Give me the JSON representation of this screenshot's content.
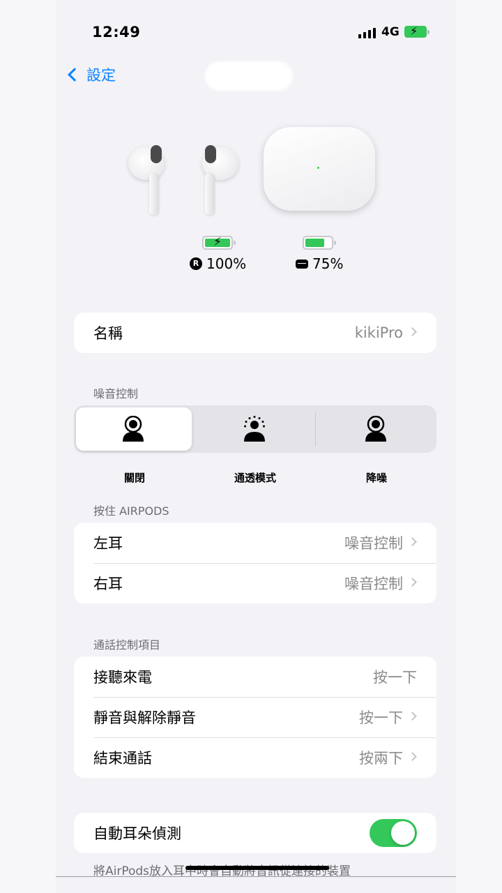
{
  "status_bar": {
    "time": "12:49",
    "network": "4G"
  },
  "nav": {
    "back_label": "設定"
  },
  "battery": {
    "buds": {
      "label": "100%",
      "badge": "R",
      "level": 1.0
    },
    "case": {
      "label": "75%",
      "level": 0.75
    }
  },
  "name_row": {
    "label": "名稱",
    "value": "kikiPro"
  },
  "noise_control": {
    "header": "噪音控制",
    "options": [
      {
        "label": "關閉",
        "icon": "person-off-icon"
      },
      {
        "label": "通透模式",
        "icon": "person-transparency-icon"
      },
      {
        "label": "降噪",
        "icon": "person-noise-cancel-icon"
      }
    ],
    "selected_index": 0
  },
  "press_hold": {
    "header": "按住 AIRPODS",
    "rows": [
      {
        "label": "左耳",
        "value": "噪音控制"
      },
      {
        "label": "右耳",
        "value": "噪音控制"
      }
    ]
  },
  "call_controls": {
    "header": "通話控制項目",
    "rows": [
      {
        "label": "接聽來電",
        "value": "按一下"
      },
      {
        "label": "靜音與解除靜音",
        "value": "按一下"
      },
      {
        "label": "結束通話",
        "value": "按兩下"
      }
    ]
  },
  "ear_detection": {
    "label": "自動耳朵偵測",
    "enabled": true,
    "footnote": "將AirPods放入耳中時會自動將音訊從連接的裝置"
  },
  "colors": {
    "accent": "#0a84ff",
    "toggle_on": "#34c759",
    "battery": "#34c759"
  }
}
